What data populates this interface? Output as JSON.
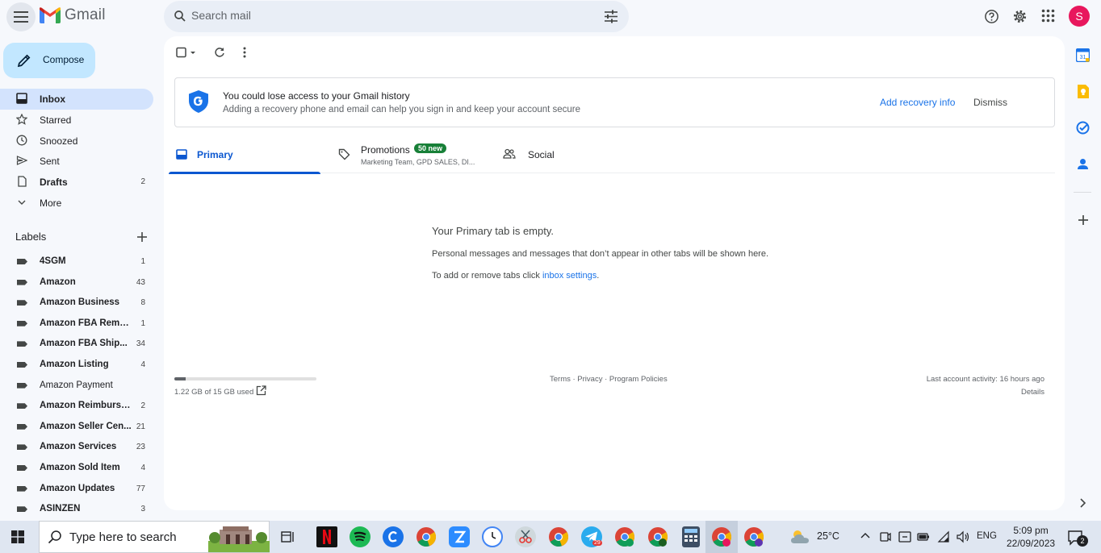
{
  "app": {
    "name": "Gmail"
  },
  "search": {
    "placeholder": "Search mail"
  },
  "user": {
    "avatar_letter": "S"
  },
  "compose": {
    "label": "Compose"
  },
  "nav": [
    {
      "label": "Inbox",
      "count": "",
      "active": true,
      "bold": true,
      "icon": "inbox-icon"
    },
    {
      "label": "Starred",
      "count": "",
      "icon": "star-icon"
    },
    {
      "label": "Snoozed",
      "count": "",
      "icon": "clock-icon"
    },
    {
      "label": "Sent",
      "count": "",
      "icon": "send-icon"
    },
    {
      "label": "Drafts",
      "count": "2",
      "bold": true,
      "icon": "draft-icon"
    },
    {
      "label": "More",
      "count": "",
      "icon": "chevron-down-icon"
    }
  ],
  "labels": {
    "heading": "Labels",
    "items": [
      {
        "label": "4SGM",
        "count": "1",
        "bold": true
      },
      {
        "label": "Amazon",
        "count": "43",
        "bold": true
      },
      {
        "label": "Amazon Business",
        "count": "8",
        "bold": true
      },
      {
        "label": "Amazon FBA Remo...",
        "count": "1",
        "bold": true
      },
      {
        "label": "Amazon FBA Ship...",
        "count": "34",
        "bold": true
      },
      {
        "label": "Amazon Listing",
        "count": "4",
        "bold": true
      },
      {
        "label": "Amazon Payment",
        "count": "",
        "bold": false
      },
      {
        "label": "Amazon Reimburse...",
        "count": "2",
        "bold": true
      },
      {
        "label": "Amazon Seller Cen...",
        "count": "21",
        "bold": true
      },
      {
        "label": "Amazon Services",
        "count": "23",
        "bold": true
      },
      {
        "label": "Amazon Sold Item",
        "count": "4",
        "bold": true
      },
      {
        "label": "Amazon Updates",
        "count": "77",
        "bold": true
      },
      {
        "label": "ASINZEN",
        "count": "3",
        "bold": true
      }
    ]
  },
  "banner": {
    "title": "You could lose access to your Gmail history",
    "subtitle": "Adding a recovery phone and email can help you sign in and keep your account secure",
    "action": "Add recovery info",
    "dismiss": "Dismiss"
  },
  "tabs": [
    {
      "label": "Primary",
      "active": true
    },
    {
      "label": "Promotions",
      "badge": "50 new",
      "sub": "Marketing Team, GPD SALES, DI..."
    },
    {
      "label": "Social"
    }
  ],
  "empty": {
    "title": "Your Primary tab is empty.",
    "line1": "Personal messages and messages that don’t appear in other tabs will be shown here.",
    "line2_prefix": "To add or remove tabs click ",
    "line2_link": "inbox settings",
    "line2_suffix": "."
  },
  "footer": {
    "storage": "1.22 GB of 15 GB used",
    "storage_fraction": 0.08,
    "links": "Terms · Privacy · Program Policies",
    "activity": "Last account activity: 16 hours ago",
    "details": "Details"
  },
  "taskbar": {
    "search_placeholder": "Type here to search",
    "weather": "25°C",
    "language": "ENG",
    "time": "5:09 pm",
    "date": "22/09/2023",
    "notification_count": "2",
    "telegram_badge": "29"
  },
  "colors": {
    "accent": "#0b57d0",
    "compose_bg": "#c2e7ff",
    "active_nav": "#d3e3fd",
    "badge_green": "#188038",
    "avatar": "#e8175d"
  }
}
